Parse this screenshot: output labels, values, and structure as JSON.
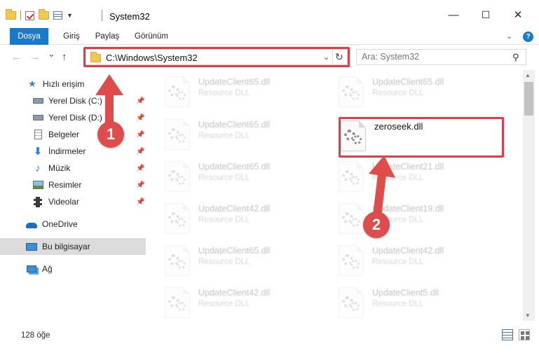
{
  "window": {
    "title": "System32",
    "controls": {
      "minimize": "—",
      "maximize": "☐",
      "close": "✕"
    }
  },
  "ribbon": {
    "tabs": [
      "Dosya",
      "Giriş",
      "Paylaş",
      "Görünüm"
    ],
    "help": "?"
  },
  "navigation": {
    "back": "←",
    "forward": "→",
    "recent": "⌄",
    "up": "↑",
    "address": "C:\\Windows\\System32",
    "search_placeholder": "Ara: System32"
  },
  "sidebar": {
    "items": [
      {
        "label": "Hızlı erişim",
        "icon": "star-icon",
        "pinned": false
      },
      {
        "label": "Yerel Disk (C:)",
        "icon": "drive-icon",
        "pinned": true
      },
      {
        "label": "Yerel Disk (D:)",
        "icon": "drive-icon",
        "pinned": true
      },
      {
        "label": "Belgeler",
        "icon": "documents-icon",
        "pinned": true
      },
      {
        "label": "İndirmeler",
        "icon": "download-icon",
        "pinned": true
      },
      {
        "label": "Müzik",
        "icon": "music-icon",
        "pinned": true
      },
      {
        "label": "Resimler",
        "icon": "pictures-icon",
        "pinned": true
      },
      {
        "label": "Videolar",
        "icon": "videos-icon",
        "pinned": true
      },
      {
        "label": "OneDrive",
        "icon": "cloud-icon",
        "pinned": false
      },
      {
        "label": "Bu bilgisayar",
        "icon": "computer-icon",
        "pinned": false,
        "selected": true
      },
      {
        "label": "Ağ",
        "icon": "network-icon",
        "pinned": false
      }
    ]
  },
  "files": {
    "left_column": [
      {
        "name": "UpdateClient65.dll",
        "type": "Resource DLL"
      },
      {
        "name": "UpdateClient65.dll",
        "type": "Resource DLL"
      },
      {
        "name": "UpdateClient65.dll",
        "type": "Resource DLL"
      },
      {
        "name": "UpdateClient42.dll",
        "type": "Resource DLL"
      },
      {
        "name": "UpdateClient65.dll",
        "type": "Resource DLL"
      },
      {
        "name": "UpdateClient42.dll",
        "type": "Resource DLL"
      }
    ],
    "right_column": [
      {
        "name": "UpdateClient65.dll",
        "type": "Resource DLL"
      },
      {
        "name": "zeroseek.dll",
        "type": "",
        "highlighted": true
      },
      {
        "name": "UpdateClient21.dll",
        "type": "Resource DLL"
      },
      {
        "name": "UpdateClient19.dll",
        "type": "Resource DLL"
      },
      {
        "name": "UpdateClient42.dll",
        "type": "Resource DLL"
      },
      {
        "name": "UpdateClient5.dll",
        "type": "Resource DLL"
      }
    ]
  },
  "status": {
    "item_count": "128 öğe"
  },
  "callouts": [
    "1",
    "2"
  ],
  "colors": {
    "accent": "#1979ca",
    "annotation": "#d9414a"
  }
}
